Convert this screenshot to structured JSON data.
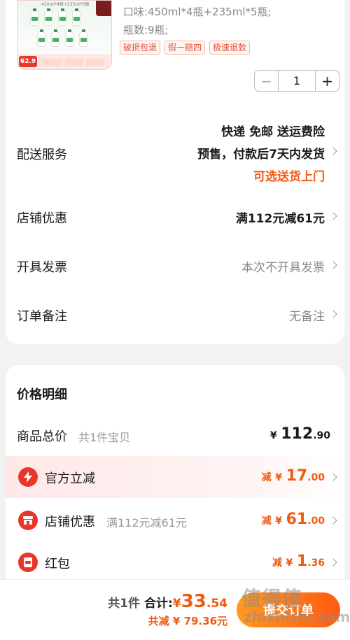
{
  "product": {
    "thumbnail_caption": "450ml*4瓶+235ml*5瓶",
    "thumbnail_price": "62.9",
    "spec_flavor": "口味:450ml*4瓶+235ml*5瓶;",
    "spec_count": "瓶数:9瓶;",
    "tags": [
      "破损包退",
      "假一赔四",
      "极速退款"
    ],
    "quantity": "1",
    "minus_symbol": "−",
    "plus_symbol": "+"
  },
  "delivery": {
    "label": "配送服务",
    "line1": "快递 免邮 送运费险",
    "line2": "预售，付款后7天内发货",
    "line3": "可选送货上门"
  },
  "store_discount": {
    "label": "店铺优惠",
    "value": "满112元减61元"
  },
  "invoice": {
    "label": "开具发票",
    "value": "本次不开具发票"
  },
  "remark": {
    "label": "订单备注",
    "value": "无备注"
  },
  "price_detail": {
    "title": "价格明细",
    "total": {
      "label": "商品总价",
      "sub": "共1件宝贝",
      "yen": "¥",
      "int": "112",
      "dec": ".90"
    },
    "official": {
      "label": "官方立减",
      "prefix": "减",
      "yen": "¥",
      "int": "17",
      "dec": ".00"
    },
    "store": {
      "label": "店铺优惠",
      "sub": "满112元减61元",
      "prefix": "减",
      "yen": "¥",
      "int": "61",
      "dec": ".00"
    },
    "redpacket": {
      "label": "红包",
      "prefix": "减",
      "yen": "¥",
      "int": "1",
      "dec": ".36"
    }
  },
  "footer": {
    "count": "共1件",
    "total_label": "合计:",
    "yen": "¥",
    "int": "33",
    "dec": ".54",
    "saved": "共减 ¥ 79.36元",
    "submit_label": "提交订单",
    "watermark": "值得值",
    "watermark_sub": "zhizhizhi.com"
  }
}
